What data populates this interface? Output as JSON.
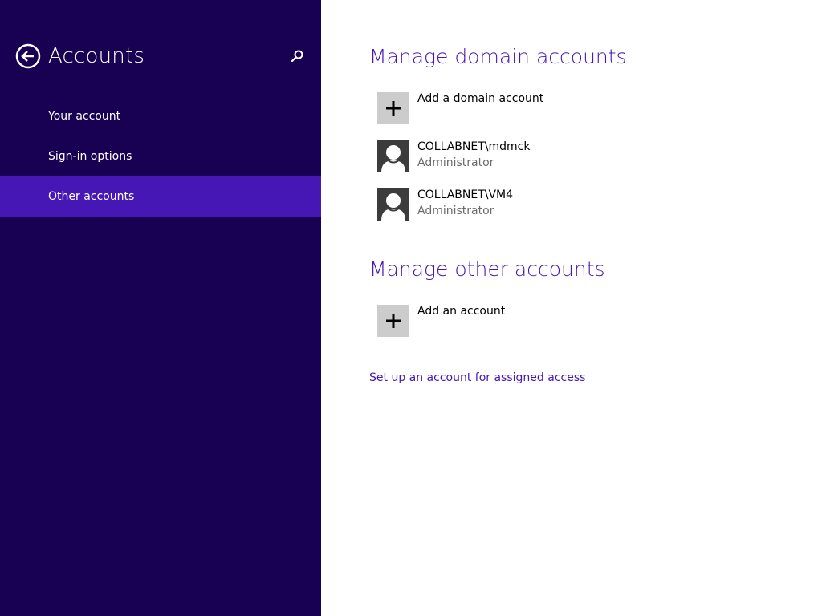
{
  "sidebar": {
    "title": "Accounts",
    "back_icon": "back-arrow-icon",
    "search_icon": "search-icon",
    "items": [
      {
        "label": "Your account",
        "selected": false
      },
      {
        "label": "Sign-in options",
        "selected": false
      },
      {
        "label": "Other accounts",
        "selected": true
      }
    ]
  },
  "main": {
    "domain_section": {
      "heading": "Manage domain accounts",
      "add_label": "Add a domain account",
      "accounts": [
        {
          "name": "COLLABNET\\mdmck",
          "role": "Administrator"
        },
        {
          "name": "COLLABNET\\VM4",
          "role": "Administrator"
        }
      ]
    },
    "other_section": {
      "heading": "Manage other accounts",
      "add_label": "Add an account"
    },
    "assigned_access_link": "Set up an account for assigned access"
  },
  "colors": {
    "sidebar_bg": "#180052",
    "selected_bg": "#4617b4",
    "accent": "#4617b4",
    "tile_add_bg": "#cccccc",
    "user_icon": "#3c3c3c"
  }
}
